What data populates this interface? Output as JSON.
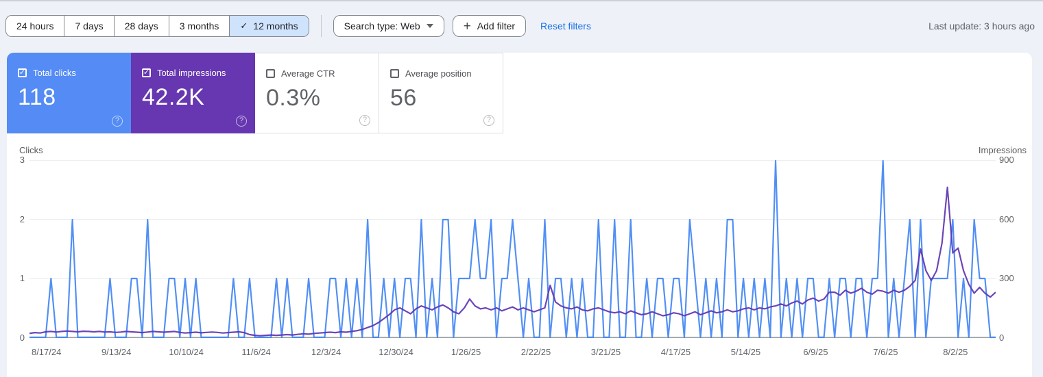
{
  "toolbar": {
    "date_ranges": [
      "24 hours",
      "7 days",
      "28 days",
      "3 months",
      "12 months"
    ],
    "selected_index": 4,
    "search_type_label": "Search type: Web",
    "add_filter_label": "Add filter",
    "reset_filters_label": "Reset filters",
    "last_update": "Last update: 3 hours ago"
  },
  "icons": {
    "check": "✓",
    "plus": "+",
    "help": "?"
  },
  "colors": {
    "clicks_accent": "#548bf4",
    "impressions_accent": "#6637b0",
    "clicks_line": "#4285f4",
    "impressions_line": "#5e35b1",
    "grid": "#e8eaed",
    "baseline": "#9aa0a6"
  },
  "metrics": [
    {
      "label": "Total clicks",
      "value": "118",
      "checked": true,
      "color": "#548bf4"
    },
    {
      "label": "Total impressions",
      "value": "42.2K",
      "checked": true,
      "color": "#6637b0"
    },
    {
      "label": "Average CTR",
      "value": "0.3%",
      "checked": false,
      "color": null
    },
    {
      "label": "Average position",
      "value": "56",
      "checked": false,
      "color": null
    }
  ],
  "chart_data": {
    "type": "line",
    "left_axis": {
      "label": "Clicks",
      "ticks": [
        3,
        2,
        1,
        0
      ],
      "max": 3
    },
    "right_axis": {
      "label": "Impressions",
      "ticks": [
        900,
        600,
        300,
        0
      ],
      "max": 900
    },
    "x_ticks": [
      "8/17/24",
      "9/13/24",
      "10/10/24",
      "11/6/24",
      "12/3/24",
      "12/30/24",
      "1/26/25",
      "2/22/25",
      "3/21/25",
      "4/17/25",
      "5/14/25",
      "6/9/25",
      "7/6/25",
      "8/2/25"
    ],
    "x_tick_days": [
      0,
      27,
      54,
      81,
      108,
      135,
      162,
      189,
      216,
      243,
      270,
      297,
      324,
      351
    ],
    "total_days": 360,
    "sample_interval_days": 2,
    "series": [
      {
        "name": "Clicks",
        "axis": "left",
        "color": "#4285f4",
        "values": [
          0,
          0,
          0,
          0,
          1,
          0,
          0,
          0,
          2,
          0,
          0,
          0,
          0,
          0,
          0,
          1,
          0,
          0,
          0,
          1,
          1,
          0,
          2,
          0,
          0,
          0,
          1,
          1,
          0,
          1,
          0,
          1,
          0,
          0,
          0,
          0,
          0,
          0,
          1,
          0,
          0,
          1,
          0,
          0,
          0,
          0,
          1,
          0,
          1,
          0,
          0,
          0,
          1,
          0,
          0,
          0,
          1,
          1,
          0,
          1,
          0,
          1,
          0,
          2,
          0,
          0,
          1,
          0,
          1,
          0,
          1,
          1,
          0,
          2,
          0,
          1,
          0,
          2,
          2,
          0,
          1,
          1,
          1,
          2,
          1,
          1,
          2,
          0,
          1,
          1,
          2,
          1,
          0,
          1,
          0,
          0,
          2,
          0,
          1,
          1,
          0,
          1,
          0,
          1,
          0,
          0,
          2,
          0,
          0,
          2,
          0,
          0,
          2,
          0,
          0,
          1,
          0,
          1,
          1,
          0,
          1,
          1,
          0,
          2,
          1,
          0,
          1,
          0,
          1,
          0,
          2,
          2,
          0,
          1,
          0,
          1,
          0,
          1,
          0,
          3,
          0,
          1,
          0,
          1,
          0,
          1,
          1,
          0,
          0,
          1,
          0,
          1,
          1,
          0,
          1,
          1,
          0,
          1,
          1,
          3,
          0,
          1,
          0,
          1,
          2,
          0,
          2,
          0,
          1,
          1,
          1,
          1,
          2,
          0,
          1,
          0,
          2,
          1,
          1,
          0,
          0
        ]
      },
      {
        "name": "Impressions",
        "axis": "right",
        "color": "#5e35b1",
        "values": [
          20,
          24,
          22,
          28,
          30,
          27,
          30,
          32,
          30,
          28,
          31,
          30,
          28,
          30,
          27,
          28,
          25,
          27,
          30,
          28,
          26,
          24,
          27,
          30,
          28,
          26,
          28,
          30,
          25,
          22,
          24,
          26,
          23,
          25,
          27,
          25,
          22,
          24,
          26,
          28,
          24,
          14,
          10,
          8,
          10,
          12,
          10,
          12,
          14,
          12,
          15,
          18,
          16,
          20,
          22,
          24,
          26,
          24,
          28,
          26,
          30,
          34,
          40,
          50,
          60,
          75,
          95,
          115,
          140,
          150,
          135,
          120,
          145,
          160,
          150,
          140,
          155,
          165,
          150,
          130,
          120,
          150,
          195,
          160,
          145,
          150,
          140,
          150,
          135,
          145,
          155,
          140,
          150,
          140,
          130,
          140,
          150,
          265,
          180,
          160,
          150,
          145,
          155,
          140,
          135,
          145,
          150,
          140,
          130,
          125,
          130,
          120,
          135,
          125,
          115,
          120,
          130,
          120,
          110,
          115,
          125,
          120,
          110,
          120,
          130,
          115,
          125,
          135,
          125,
          130,
          140,
          130,
          135,
          145,
          150,
          140,
          150,
          145,
          155,
          160,
          170,
          160,
          175,
          185,
          170,
          190,
          200,
          185,
          195,
          230,
          230,
          215,
          240,
          225,
          235,
          250,
          230,
          220,
          240,
          235,
          225,
          240,
          230,
          240,
          260,
          290,
          450,
          340,
          290,
          340,
          480,
          765,
          430,
          455,
          340,
          270,
          225,
          255,
          225,
          205,
          230
        ]
      }
    ]
  }
}
